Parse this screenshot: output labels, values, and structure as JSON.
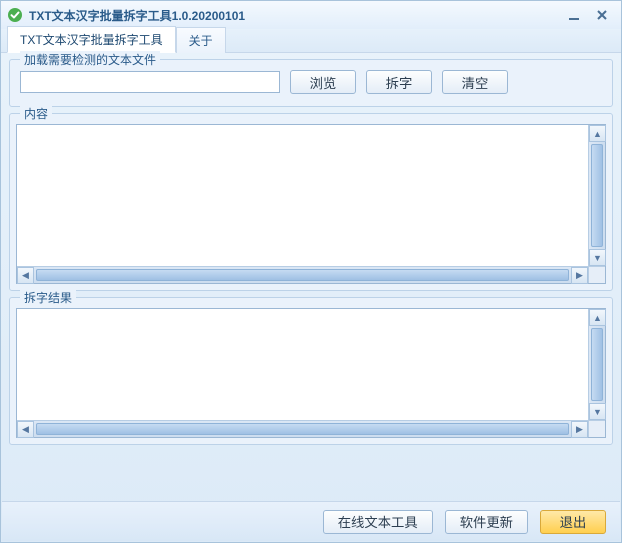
{
  "titlebar": {
    "title": "TXT文本汉字批量拆字工具1.0.20200101"
  },
  "tabs": {
    "main": "TXT文本汉字批量拆字工具",
    "about": "关于"
  },
  "load_group": {
    "legend": "加载需要检测的文本文件",
    "path_value": "",
    "browse": "浏览",
    "split": "拆字",
    "clear": "清空"
  },
  "content_group": {
    "legend": "内容",
    "text": ""
  },
  "result_group": {
    "legend": "拆字结果",
    "text": ""
  },
  "bottom": {
    "online_tools": "在线文本工具",
    "update": "软件更新",
    "exit": "退出"
  }
}
